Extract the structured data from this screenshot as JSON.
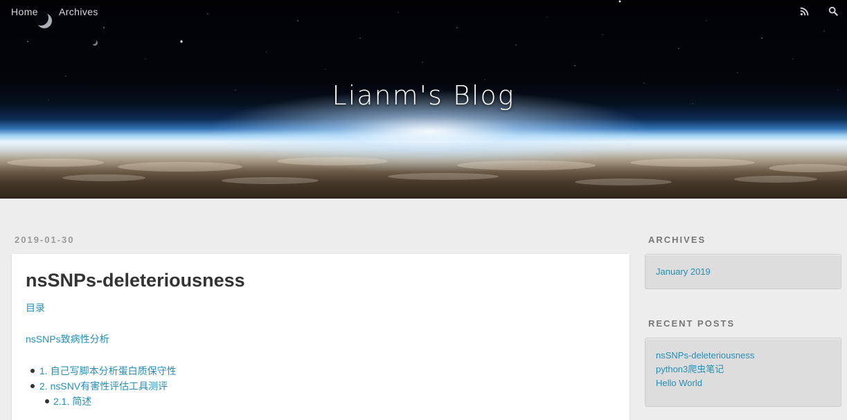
{
  "header": {
    "nav": [
      {
        "label": "Home"
      },
      {
        "label": "Archives"
      }
    ],
    "icons": [
      "rss-icon",
      "search-icon"
    ],
    "title": "Lianm's Blog"
  },
  "post": {
    "date": "2019-01-30",
    "title": "nsSNPs-deleteriousness",
    "toc_label": "目录",
    "section_link": "nsSNPs致病性分析",
    "toc": [
      {
        "label": "1. 自己写脚本分析蛋白质保守性",
        "level": 1
      },
      {
        "label": "2. nsSNV有害性评估工具测评",
        "level": 1
      },
      {
        "label": "2.1. 简述",
        "level": 2
      }
    ]
  },
  "sidebar": {
    "archives": {
      "title": "ARCHIVES",
      "items": [
        "January 2019"
      ]
    },
    "recent_posts": {
      "title": "RECENT POSTS",
      "items": [
        "nsSNPs-deleteriousness",
        "python3爬虫笔记",
        "Hello World"
      ]
    }
  },
  "colors": {
    "link": "#258fb8",
    "page_background": "#ededed",
    "card": "#ffffff",
    "widget_background": "#dddddd"
  }
}
